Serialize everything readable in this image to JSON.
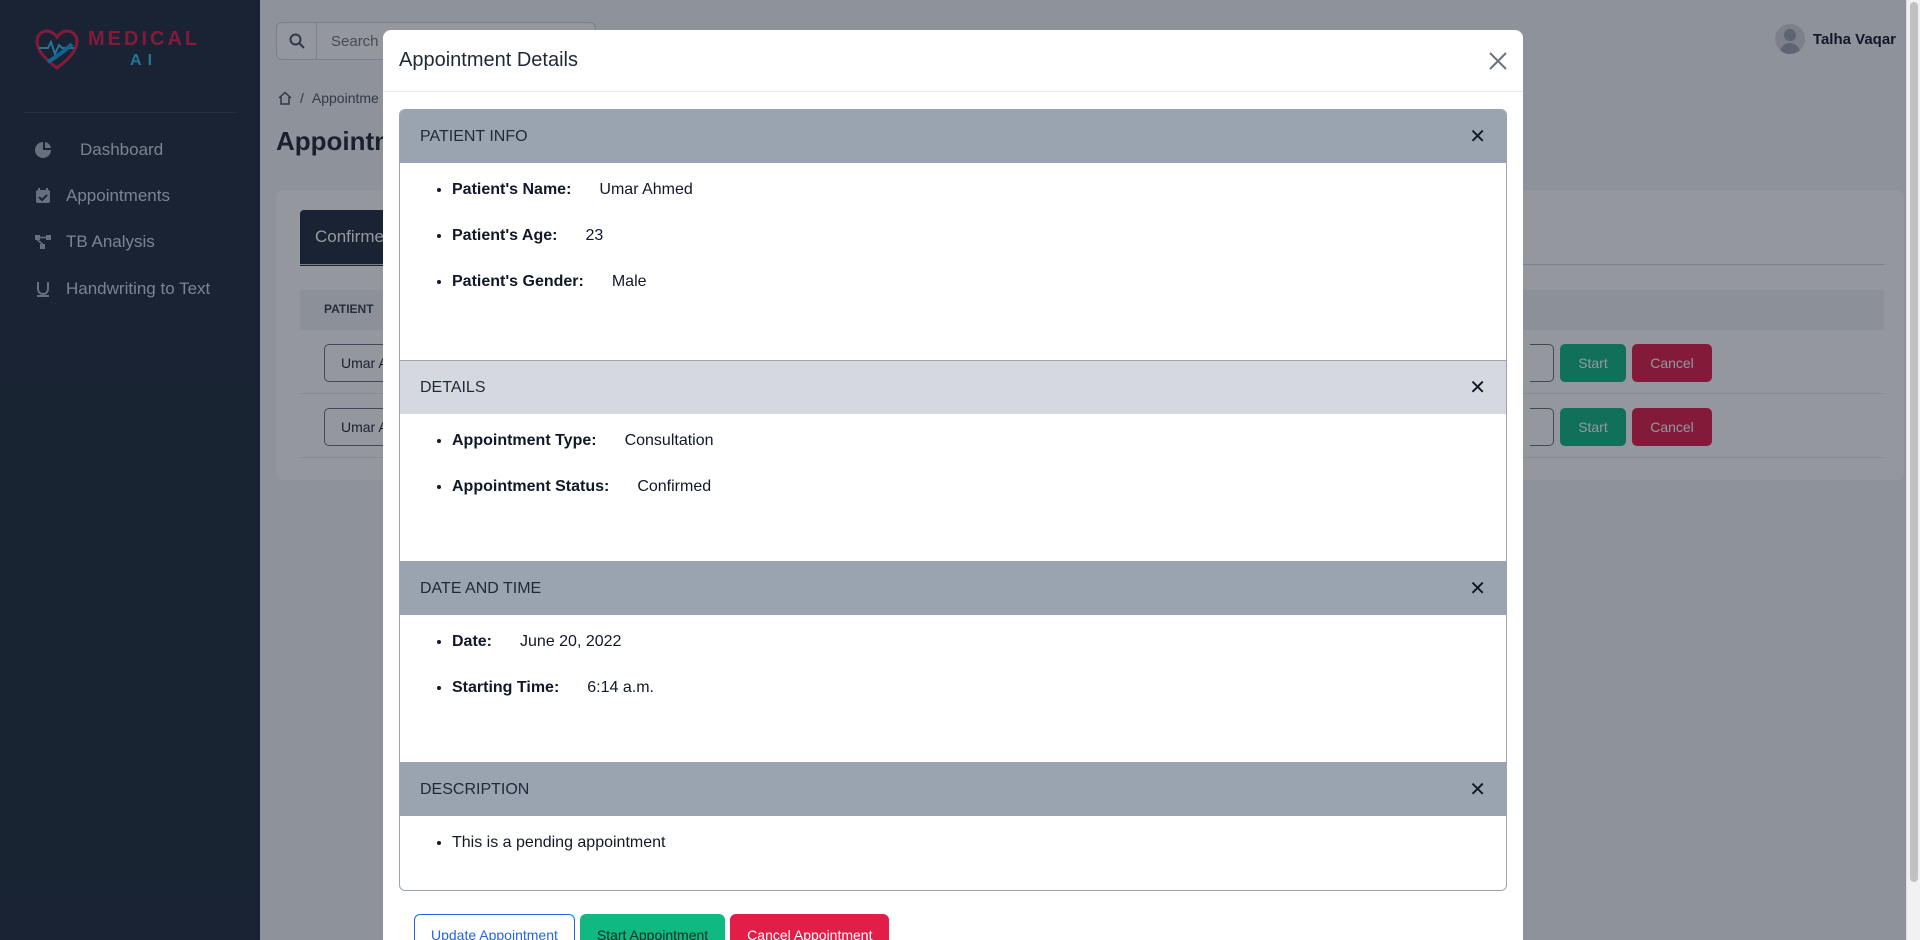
{
  "sidebar": {
    "logo": {
      "line1": "MEDICAL",
      "line2": "AI"
    },
    "items": [
      {
        "label": "Dashboard",
        "icon": "pie-chart-icon"
      },
      {
        "label": "Appointments",
        "icon": "calendar-check-icon"
      },
      {
        "label": "TB Analysis",
        "icon": "diagram-icon"
      },
      {
        "label": "Handwriting to Text",
        "icon": "underline-icon"
      }
    ]
  },
  "header": {
    "search_placeholder": "Search",
    "user_name": "Talha Vaqar"
  },
  "page": {
    "breadcrumb": "Appointme",
    "title": "Appointm",
    "active_tab": "Confirme",
    "column_patient": "PATIENT",
    "rows": [
      {
        "patient": "Umar A",
        "start": "Start",
        "cancel": "Cancel"
      },
      {
        "patient": "Umar A",
        "start": "Start",
        "cancel": "Cancel"
      }
    ]
  },
  "modal": {
    "title": "Appointment Details",
    "sections": {
      "patient_info": {
        "heading": "PATIENT INFO",
        "name_label": "Patient's Name:",
        "name_value": "Umar Ahmed",
        "age_label": "Patient's Age:",
        "age_value": "23",
        "gender_label": "Patient's Gender:",
        "gender_value": "Male"
      },
      "details": {
        "heading": "DETAILS",
        "type_label": "Appointment Type:",
        "type_value": "Consultation",
        "status_label": "Appointment Status:",
        "status_value": "Confirmed"
      },
      "date_time": {
        "heading": "DATE AND TIME",
        "date_label": "Date:",
        "date_value": "June 20, 2022",
        "time_label": "Starting Time:",
        "time_value": "6:14 a.m."
      },
      "description": {
        "heading": "DESCRIPTION",
        "text": "This is a pending appointment"
      }
    },
    "buttons": {
      "update": "Update Appointment",
      "start": "Start Appointment",
      "cancel": "Cancel Appointment"
    }
  },
  "colors": {
    "sidebar_bg": "#1f2d3d",
    "success": "#10b981",
    "danger": "#e11d48",
    "primary": "#2563eb"
  }
}
